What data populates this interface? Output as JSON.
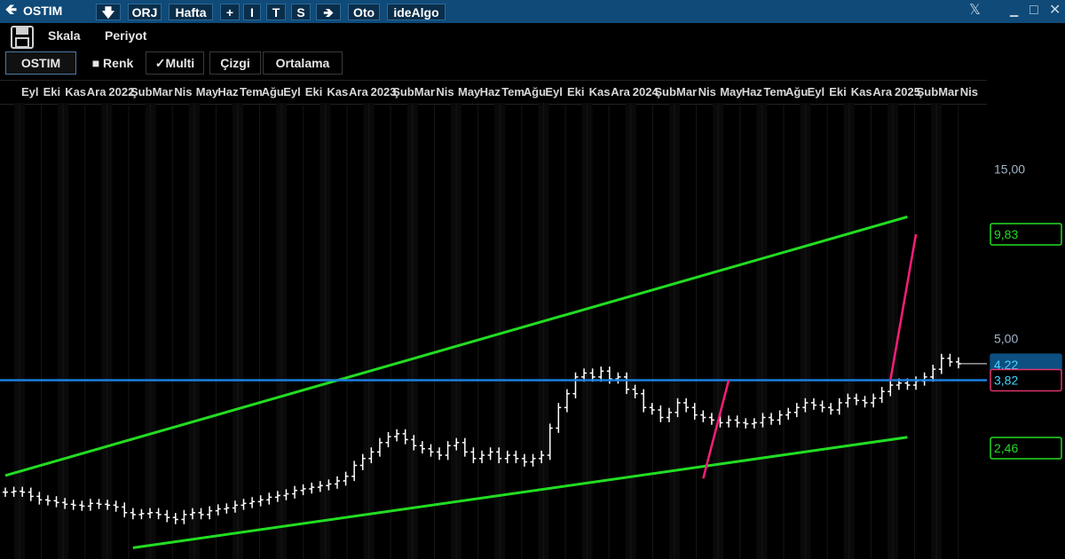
{
  "titlebar": {
    "symbol": "OSTIM",
    "buttons": [
      "ORJ",
      "Hafta",
      "+",
      "I",
      "T",
      "S",
      "Oto",
      "ideAlgo"
    ],
    "window_controls": [
      "𝕏",
      "□",
      "✕"
    ]
  },
  "toolbar": {
    "scale_label": "Skala",
    "period_label": "Periyot"
  },
  "tabs": [
    {
      "label": "OSTIM",
      "active": true
    },
    {
      "label": "■ Renk",
      "active": false
    },
    {
      "label": "✓Multi",
      "active": false
    },
    {
      "label": "Çizgi",
      "active": false
    },
    {
      "label": "Ortalama",
      "active": false
    }
  ],
  "colors": {
    "background": "#000000",
    "titlebar": "#0f4a78",
    "price_bars": "#ffffff",
    "channel_lines": "#22dd22",
    "horizontal_line": "#1a7fe0",
    "projection_lines": "#ff1d7a",
    "last_price_box": "#0c4f80",
    "last_price_text": "#45d6ff",
    "label_green": "#22dd22",
    "label_red": "#e0336a"
  },
  "chart_data": {
    "type": "ohlc",
    "title": "",
    "xlabel": "",
    "ylabel": "",
    "ylim": [
      1.2,
      23
    ],
    "y_scale": "log",
    "grid": true,
    "y_ticks": [
      "15,00",
      "5,00"
    ],
    "x_ticks": [
      "Eyl",
      "Eki",
      "Kas",
      "Ara",
      "2022",
      "Şub",
      "Mar",
      "Nis",
      "May",
      "Haz",
      "Tem",
      "Ağu",
      "Eyl",
      "Eki",
      "Kas",
      "Ara",
      "2023",
      "Şub",
      "Mar",
      "Nis",
      "May",
      "Haz",
      "Tem",
      "Ağu",
      "Eyl",
      "Eki",
      "Kas",
      "Ara",
      "2024",
      "Şub",
      "Mar",
      "Nis",
      "May",
      "Haz",
      "Tem",
      "Ağu",
      "Eyl",
      "Eki",
      "Kas",
      "Ara",
      "2025",
      "Şub",
      "Mar",
      "Nis"
    ],
    "series": [
      {
        "points_close": [
          1.85,
          1.86,
          1.85,
          1.8,
          1.76,
          1.75,
          1.73,
          1.71,
          1.7,
          1.69,
          1.72,
          1.71,
          1.7,
          1.68,
          1.62,
          1.6,
          1.61,
          1.62,
          1.6,
          1.57,
          1.55,
          1.6,
          1.62,
          1.6,
          1.64,
          1.66,
          1.67,
          1.7,
          1.72,
          1.74,
          1.76,
          1.79,
          1.81,
          1.83,
          1.87,
          1.89,
          1.91,
          1.93,
          1.95,
          1.99,
          2.05,
          2.2,
          2.3,
          2.4,
          2.55,
          2.65,
          2.7,
          2.6,
          2.5,
          2.45,
          2.4,
          2.35,
          2.5,
          2.55,
          2.4,
          2.3,
          2.35,
          2.4,
          2.3,
          2.35,
          2.3,
          2.25,
          2.3,
          2.35,
          2.8,
          3.2,
          3.5,
          3.9,
          4.0,
          3.9,
          4.05,
          3.85,
          3.9,
          3.6,
          3.5,
          3.2,
          3.15,
          3.0,
          3.1,
          3.3,
          3.2,
          3.05,
          3.0,
          2.95,
          2.9,
          2.95,
          2.9,
          2.88,
          2.9,
          3.0,
          2.95,
          3.05,
          3.1,
          3.2,
          3.3,
          3.25,
          3.2,
          3.15,
          3.3,
          3.4,
          3.35,
          3.3,
          3.4,
          3.55,
          3.7,
          3.75,
          3.7,
          3.8,
          3.9,
          4.1,
          4.4,
          4.3,
          4.25
        ],
        "bar_count": 113
      }
    ],
    "annotations": {
      "trend_channel_upper": {
        "from": [
          0,
          2.06
        ],
        "to": [
          106,
          11.0
        ]
      },
      "trend_channel_lower": {
        "from": [
          15,
          1.29
        ],
        "to": [
          106,
          2.64
        ]
      },
      "horizontal_line": 3.82,
      "projection_lines": [
        {
          "from": [
            82,
            2.02
          ],
          "to": [
            85,
            3.82
          ]
        },
        {
          "from": [
            104,
            3.82
          ],
          "to": [
            107,
            9.83
          ]
        }
      ],
      "price_labels": [
        {
          "text": "9,83",
          "value": 9.83,
          "style": "green"
        },
        {
          "text": "4,22",
          "value": 4.22,
          "style": "last"
        },
        {
          "text": "3,82",
          "value": 3.82,
          "style": "red"
        },
        {
          "text": "2,46",
          "value": 2.46,
          "style": "green"
        }
      ]
    }
  }
}
